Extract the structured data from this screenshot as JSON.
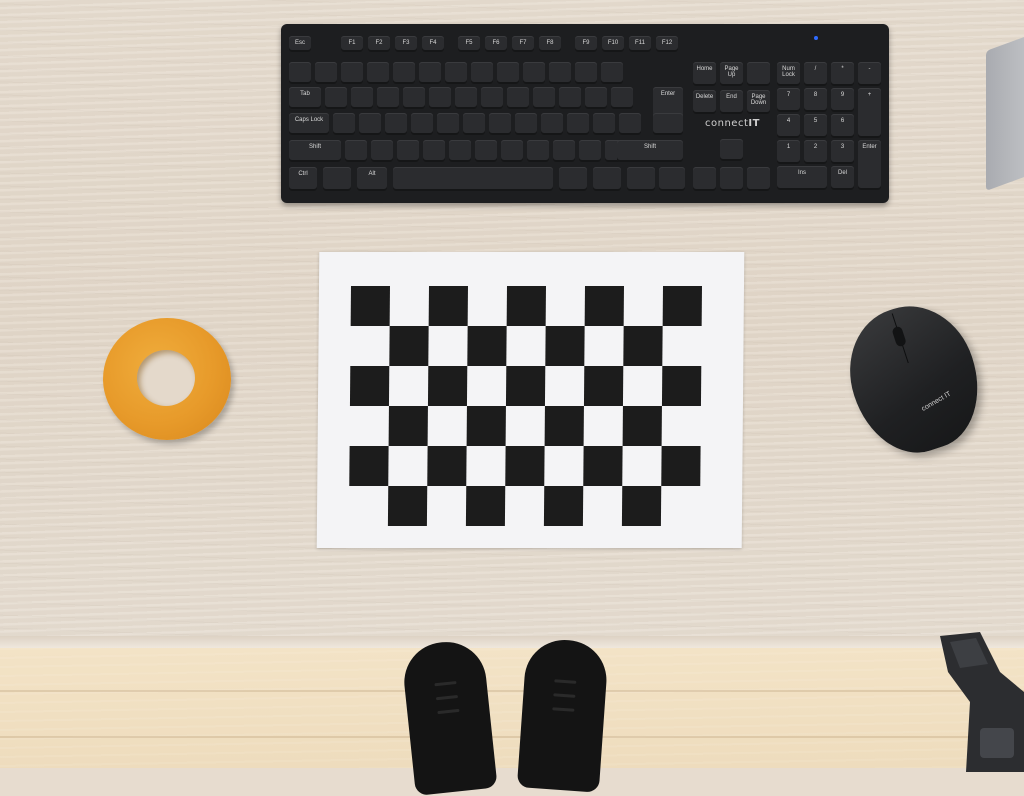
{
  "keyboard": {
    "brand": "connect",
    "brand_suffix": "IT",
    "keys": [
      "Esc",
      "F1",
      "F2",
      "F3",
      "F4",
      "F5",
      "F6",
      "F7",
      "F8",
      "F9",
      "F10",
      "F11",
      "F12",
      "Tab",
      "Caps Lock",
      "Shift",
      "Ctrl",
      "Alt",
      "Enter",
      "Delete",
      "End",
      "Home",
      "Page Up",
      "Page Down",
      "Num Lock",
      "Ins",
      "Del"
    ]
  },
  "mouse": {
    "brand": "connect IT"
  },
  "colors": {
    "desk": "#e6dccf",
    "floor": "#f0dfc1",
    "grip_ring": "#e79a2a",
    "mouse": "#1f2022",
    "keyboard": "#1d1e20",
    "checker_dark": "#1c1c1c",
    "paper": "#f4f4f6"
  },
  "checkerboard": {
    "rows": 6,
    "cols": 9
  }
}
